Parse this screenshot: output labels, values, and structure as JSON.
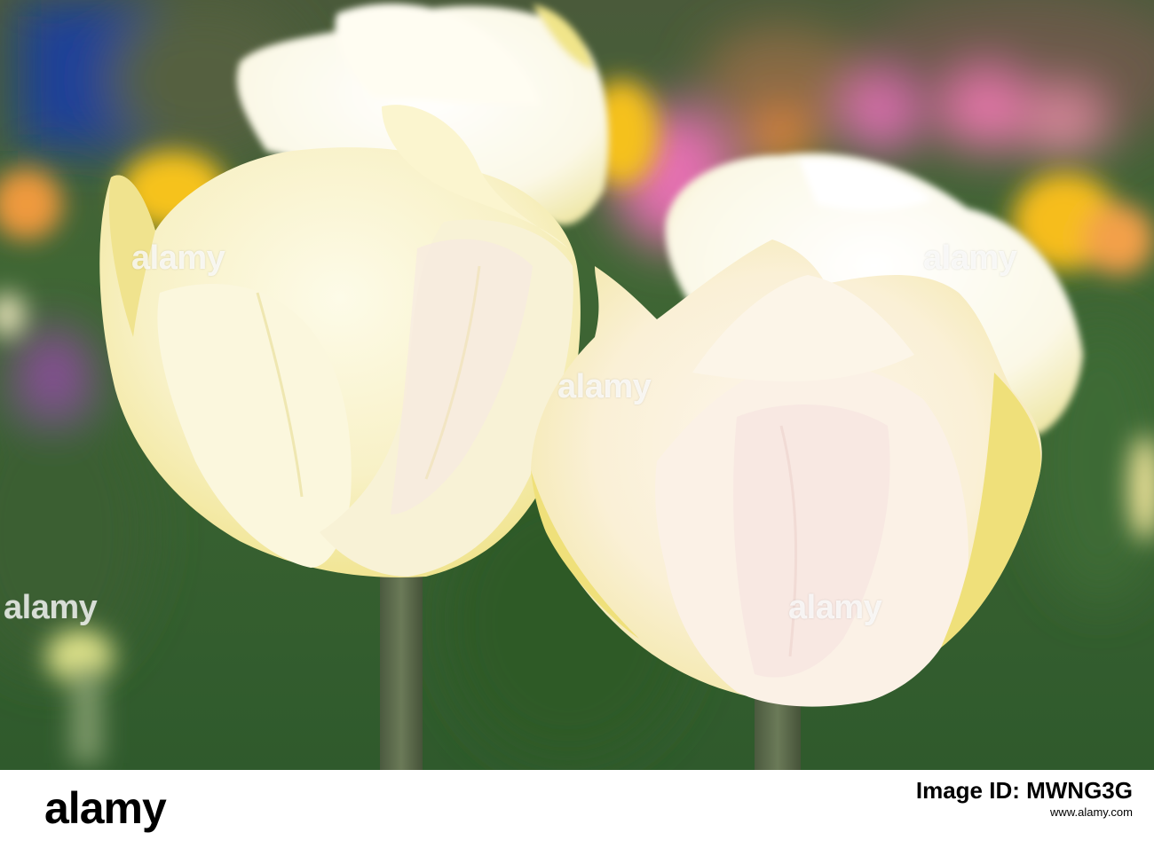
{
  "image": {
    "subject": "cream-white tulips",
    "colors": {
      "background_green": "#3e6a33",
      "petal_cream": "#fbf6d8",
      "petal_yellow": "#f1e58a",
      "blur_pink": "#e46fb0",
      "blur_yellow": "#f6c21a",
      "blur_orange": "#ef9a3c",
      "pot_blue": "#1d3f9a",
      "stem": "#5b6a4c"
    }
  },
  "watermarks": [
    "alamy",
    "alamy",
    "alamy",
    "alamy",
    "alamy"
  ],
  "footer": {
    "logo": "alamy",
    "image_id_label": "Image ID: MWNG3G",
    "site": "www.alamy.com"
  }
}
